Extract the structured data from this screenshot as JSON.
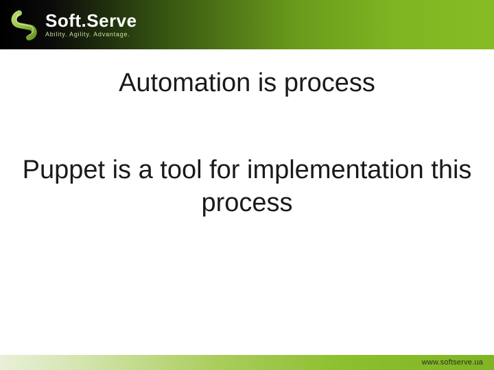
{
  "brand": {
    "name": "Soft.Serve",
    "tagline": "Ability. Agility. Advantage."
  },
  "slide": {
    "title": "Automation is process",
    "body": "Puppet is a tool for implementation this process"
  },
  "footer": {
    "url": "www.softserve.ua"
  },
  "colors": {
    "accent": "#7fb522",
    "header_dark": "#000000",
    "text": "#1a1a1a"
  }
}
